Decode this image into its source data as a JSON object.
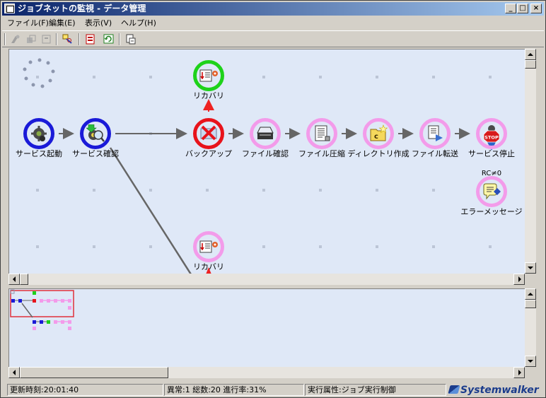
{
  "window": {
    "title": "ジョブネットの監視 - データ管理",
    "controls": {
      "minimize": "_",
      "maximize": "□",
      "close": "×"
    }
  },
  "menu": [
    {
      "id": "file",
      "label": "ファイル(F)"
    },
    {
      "id": "edit",
      "label": "編集(E)"
    },
    {
      "id": "view",
      "label": "表示(V)"
    },
    {
      "id": "help",
      "label": "ヘルプ(H)"
    }
  ],
  "toolbar": [
    {
      "id": "run",
      "icon": "run-icon",
      "enabled": false
    },
    {
      "id": "stop",
      "icon": "stop-icon",
      "enabled": false
    },
    {
      "id": "pause",
      "icon": "pause-icon",
      "enabled": false
    },
    {
      "id": "find",
      "icon": "find-icon",
      "enabled": true
    },
    {
      "id": "properties",
      "icon": "properties-icon",
      "enabled": true
    },
    {
      "id": "refresh",
      "icon": "refresh-icon",
      "enabled": true
    },
    {
      "id": "export",
      "icon": "export-icon",
      "enabled": true
    }
  ],
  "jobnet": {
    "nodes": [
      {
        "id": "service-start",
        "label": "サービス起動",
        "status": "blue",
        "icon": "service-gear-icon"
      },
      {
        "id": "service-check",
        "label": "サービス確認",
        "status": "blue",
        "icon": "service-check-icon"
      },
      {
        "id": "backup",
        "label": "バックアップ",
        "status": "red",
        "icon": "backup-error-icon"
      },
      {
        "id": "recovery-top",
        "label": "リカバリ",
        "status": "green",
        "icon": "recovery-icon"
      },
      {
        "id": "file-check",
        "label": "ファイル確認",
        "status": "pink",
        "icon": "scanner-icon"
      },
      {
        "id": "file-compress",
        "label": "ファイル圧縮",
        "status": "pink",
        "icon": "document-icon"
      },
      {
        "id": "dir-create",
        "label": "ディレクトリ作成",
        "status": "pink",
        "icon": "folder-c-icon"
      },
      {
        "id": "file-transfer",
        "label": "ファイル転送",
        "status": "pink",
        "icon": "file-transfer-icon"
      },
      {
        "id": "service-stop",
        "label": "サービス停止",
        "status": "pink",
        "icon": "stop-sign-icon"
      },
      {
        "id": "error-message",
        "label": "エラーメッセージ",
        "status": "pink",
        "icon": "message-icon"
      },
      {
        "id": "recovery-bottom",
        "label": "リカバリ",
        "status": "pink",
        "icon": "recovery-icon"
      }
    ],
    "condition_label": "RC≠0",
    "stop_sign_text": "STOP",
    "folder_letter": "c"
  },
  "colors": {
    "waiting": "#f39bea",
    "running": "#1a1ad8",
    "error": "#e8131b",
    "completed": "#1ed21a",
    "canvas": "#dfe8f7"
  },
  "status": {
    "updated": "更新時刻:20:01:40",
    "progress": "異常:1 総数:20 進行率:31%",
    "attribute": "実行属性:ジョブ実行制御"
  },
  "brand": "Systemwalker"
}
